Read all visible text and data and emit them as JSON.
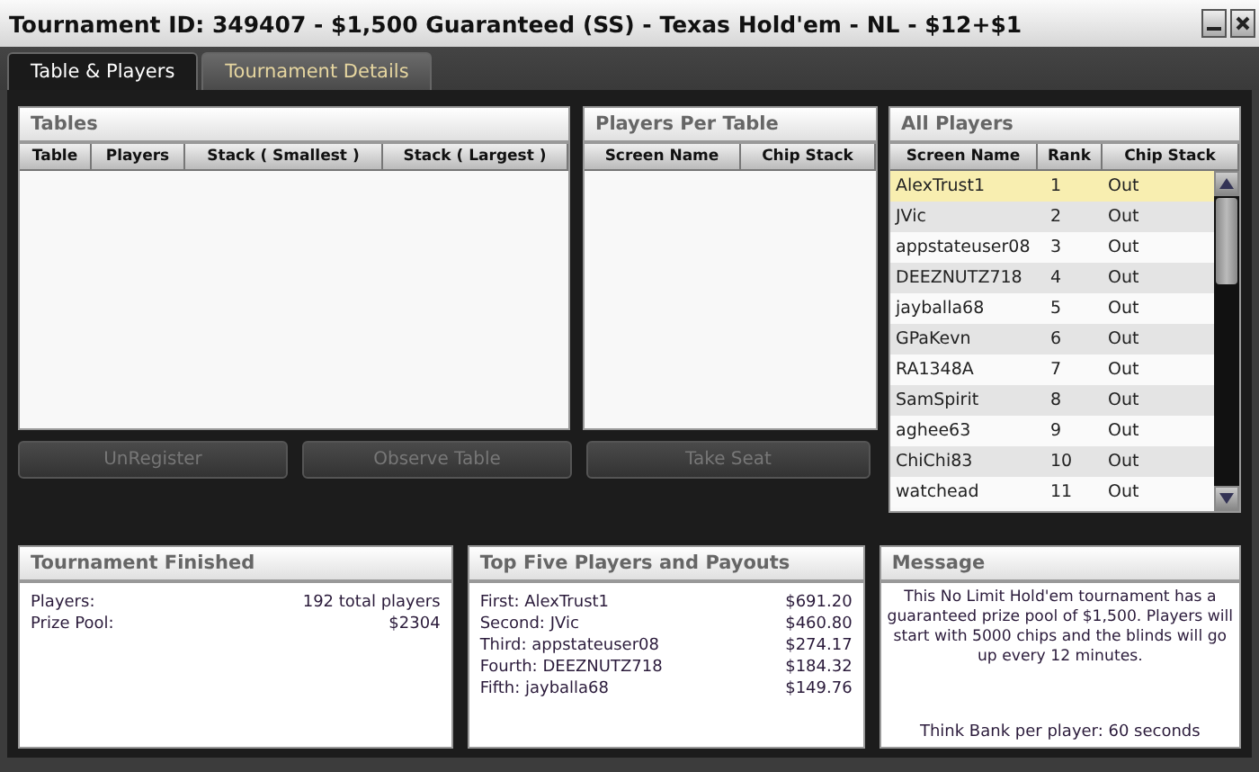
{
  "window": {
    "title": "Tournament ID: 349407 - $1,500 Guaranteed (SS) - Texas Hold'em - NL - $12+$1"
  },
  "tabs": [
    {
      "label": "Table & Players",
      "selected": true
    },
    {
      "label": "Tournament Details",
      "selected": false
    }
  ],
  "tables_panel": {
    "title": "Tables",
    "columns": [
      "Table",
      "Players",
      "Stack ( Smallest )",
      "Stack ( Largest )"
    ]
  },
  "players_per_table": {
    "title": "Players Per Table",
    "columns": [
      "Screen Name",
      "Chip Stack"
    ]
  },
  "buttons": [
    {
      "label": "UnRegister",
      "disabled": true
    },
    {
      "label": "Observe Table",
      "disabled": true
    },
    {
      "label": "Take Seat",
      "disabled": true
    }
  ],
  "all_players": {
    "title": "All Players",
    "columns": [
      "Screen Name",
      "Rank",
      "Chip Stack"
    ],
    "rows": [
      {
        "name": "AlexTrust1",
        "rank": "1",
        "chip_stack": "Out",
        "selected": true
      },
      {
        "name": "JVic",
        "rank": "2",
        "chip_stack": "Out",
        "selected": false
      },
      {
        "name": "appstateuser08",
        "rank": "3",
        "chip_stack": "Out",
        "selected": false
      },
      {
        "name": "DEEZNUTZ718",
        "rank": "4",
        "chip_stack": "Out",
        "selected": false
      },
      {
        "name": "jayballa68",
        "rank": "5",
        "chip_stack": "Out",
        "selected": false
      },
      {
        "name": "GPaKevn",
        "rank": "6",
        "chip_stack": "Out",
        "selected": false
      },
      {
        "name": "RA1348A",
        "rank": "7",
        "chip_stack": "Out",
        "selected": false
      },
      {
        "name": "SamSpirit",
        "rank": "8",
        "chip_stack": "Out",
        "selected": false
      },
      {
        "name": "aghee63",
        "rank": "9",
        "chip_stack": "Out",
        "selected": false
      },
      {
        "name": "ChiChi83",
        "rank": "10",
        "chip_stack": "Out",
        "selected": false
      },
      {
        "name": "watchead",
        "rank": "11",
        "chip_stack": "Out",
        "selected": false
      }
    ]
  },
  "tournament_finished": {
    "title": "Tournament Finished",
    "rows": [
      {
        "label": "Players:",
        "value": "192 total players"
      },
      {
        "label": "Prize Pool:",
        "value": "$2304"
      }
    ]
  },
  "top_five": {
    "title": "Top Five Players and Payouts",
    "rows": [
      {
        "label": "First: AlexTrust1",
        "value": "$691.20"
      },
      {
        "label": "Second: JVic",
        "value": "$460.80"
      },
      {
        "label": "Third: appstateuser08",
        "value": "$274.17"
      },
      {
        "label": "Fourth: DEEZNUTZ718",
        "value": "$184.32"
      },
      {
        "label": "Fifth: jayballa68",
        "value": "$149.76"
      }
    ]
  },
  "message": {
    "title": "Message",
    "body": "This No Limit Hold'em tournament has a guaranteed prize pool of $1,500. Players will start with 5000 chips and the blinds will go up every 12 minutes.",
    "footer": "Think Bank per player: 60 seconds"
  }
}
